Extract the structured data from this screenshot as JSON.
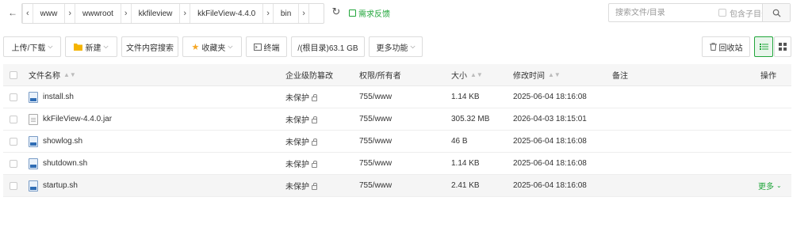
{
  "nav": {
    "back_icon": "arrow-left-icon",
    "breadcrumbs": [
      "www",
      "wwwroot",
      "kkfileview",
      "kkFileView-4.4.0",
      "bin"
    ],
    "feedback_label": "需求反馈"
  },
  "search": {
    "placeholder": "搜索文件/目录",
    "include_subdir_label": "包含子目录"
  },
  "toolbar": {
    "upload_label": "上传/下载",
    "new_label": "新建",
    "content_search_label": "文件内容搜索",
    "favorites_label": "收藏夹",
    "terminal_label": "终端",
    "disk_label": "/(根目录)63.1 GB",
    "more_label": "更多功能",
    "recycle_label": "回收站"
  },
  "table": {
    "headers": {
      "name": "文件名称",
      "protection": "企业级防篡改",
      "permission": "权限/所有者",
      "size": "大小",
      "modified": "修改时间",
      "note": "备注",
      "ops": "操作"
    },
    "rows": [
      {
        "name": "install.sh",
        "type": "sh",
        "protection": "未保护",
        "permission": "755/www",
        "size": "1.14 KB",
        "modified": "2025-06-04 18:16:08",
        "note": ""
      },
      {
        "name": "kkFileView-4.4.0.jar",
        "type": "jar",
        "protection": "未保护",
        "permission": "755/www",
        "size": "305.32 MB",
        "modified": "2026-04-03 18:15:01",
        "note": ""
      },
      {
        "name": "showlog.sh",
        "type": "sh",
        "protection": "未保护",
        "permission": "755/www",
        "size": "46 B",
        "modified": "2025-06-04 18:16:08",
        "note": ""
      },
      {
        "name": "shutdown.sh",
        "type": "sh",
        "protection": "未保护",
        "permission": "755/www",
        "size": "1.14 KB",
        "modified": "2025-06-04 18:16:08",
        "note": ""
      },
      {
        "name": "startup.sh",
        "type": "sh",
        "protection": "未保护",
        "permission": "755/www",
        "size": "2.41 KB",
        "modified": "2025-06-04 18:16:08",
        "note": "",
        "ops_label": "更多"
      }
    ]
  },
  "colors": {
    "accent": "#20a53a",
    "border": "#dcdcdc",
    "header_bg": "#f6f6f6"
  }
}
